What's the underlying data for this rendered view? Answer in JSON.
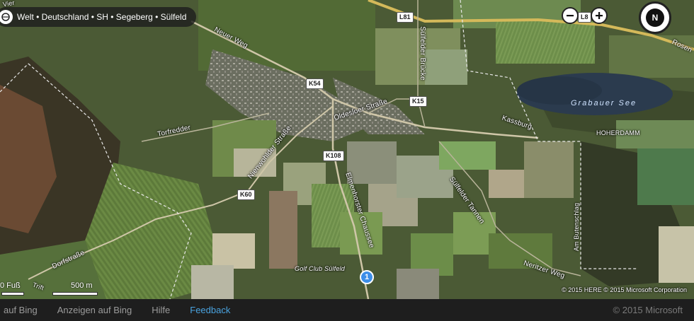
{
  "breadcrumb": {
    "text": "Welt • Deutschland • SH • Segeberg • Sülfeld"
  },
  "map_controls": {
    "zoom_out": "−",
    "zoom_in": "+",
    "compass": "N"
  },
  "road_shields": {
    "l81": "L81",
    "l8x": "L8",
    "k54": "K54",
    "k15": "K15",
    "k108": "K108",
    "k60": "K60"
  },
  "labels": {
    "neuer_weg": "Neuer Weg",
    "oldesloer": "Oldesloer Straße",
    "suelfelder_bruecke": "Sülfelder Brücke",
    "grabauer_see": "Grabauer See",
    "kassburg": "Kassburg",
    "hoherdamm": "HOHERDAMM",
    "torfredder": "Torfredder",
    "nienwohlder": "Nienwohlder Straße",
    "elmenhorster": "Elmenhorster Chaussee",
    "suelfelder_tannen": "Sülfelder Tannen",
    "am_butenschlag": "Am Butenschlag",
    "dorfstrasse": "Dorfstraße",
    "neritzer_weg": "Neritzer Weg",
    "golf_club": "Golf Club Sülfeld",
    "trift": "Trift",
    "rosen": "Rosen",
    "viertel": "Vier"
  },
  "pin": {
    "number": "1"
  },
  "scale": {
    "feet": "0 Fuß",
    "meters": "500 m"
  },
  "copyright": "© 2015 HERE  © 2015 Microsoft Corporation",
  "footer": {
    "links": [
      "auf Bing",
      "Anzeigen auf Bing",
      "Hilfe",
      "Feedback"
    ],
    "copyright": "© 2015 Microsoft"
  },
  "colors": {
    "accent_link": "#4aa3df",
    "pin": "#3d8ee8",
    "main_road": "#d4b95a"
  }
}
